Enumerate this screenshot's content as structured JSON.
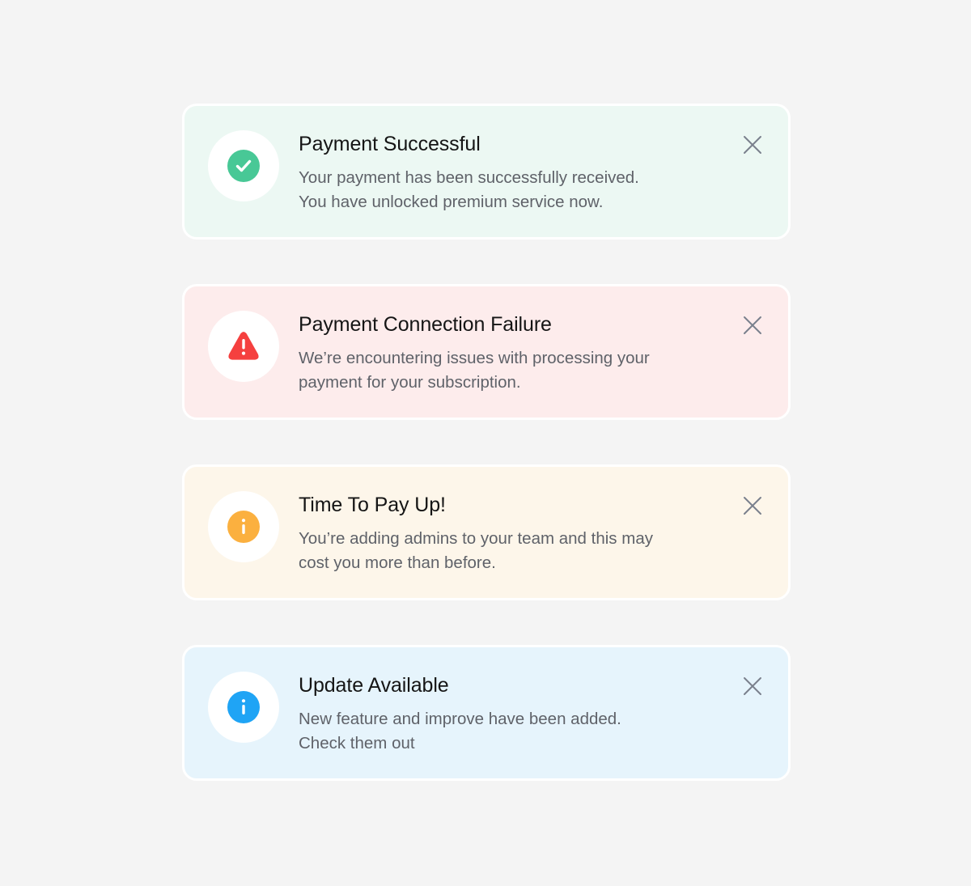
{
  "toasts": [
    {
      "type": "success",
      "icon": "check-circle-icon",
      "accent": "#48c896",
      "background": "#ecf8f3",
      "title": "Payment Successful",
      "message_lines": [
        "Your payment has been successfully received.",
        "You have unlocked premium service now."
      ]
    },
    {
      "type": "error",
      "icon": "alert-triangle-icon",
      "accent": "#f5403f",
      "background": "#fdecec",
      "title": "Payment Connection Failure",
      "message_lines": [
        "We’re encountering issues with processing your",
        "payment for your subscription."
      ]
    },
    {
      "type": "warning",
      "icon": "info-circle-icon",
      "accent": "#fbb03f",
      "background": "#fdf6ea",
      "title": "Time To Pay Up!",
      "message_lines": [
        "You’re adding admins to your team and this may",
        "cost you more than before."
      ]
    },
    {
      "type": "info",
      "icon": "info-circle-icon",
      "accent": "#1fa4f5",
      "background": "#e6f4fc",
      "title": "Update Available",
      "message_lines": [
        "New feature and improve have been added.",
        "Check them out"
      ]
    }
  ],
  "close_icon": "close-icon"
}
